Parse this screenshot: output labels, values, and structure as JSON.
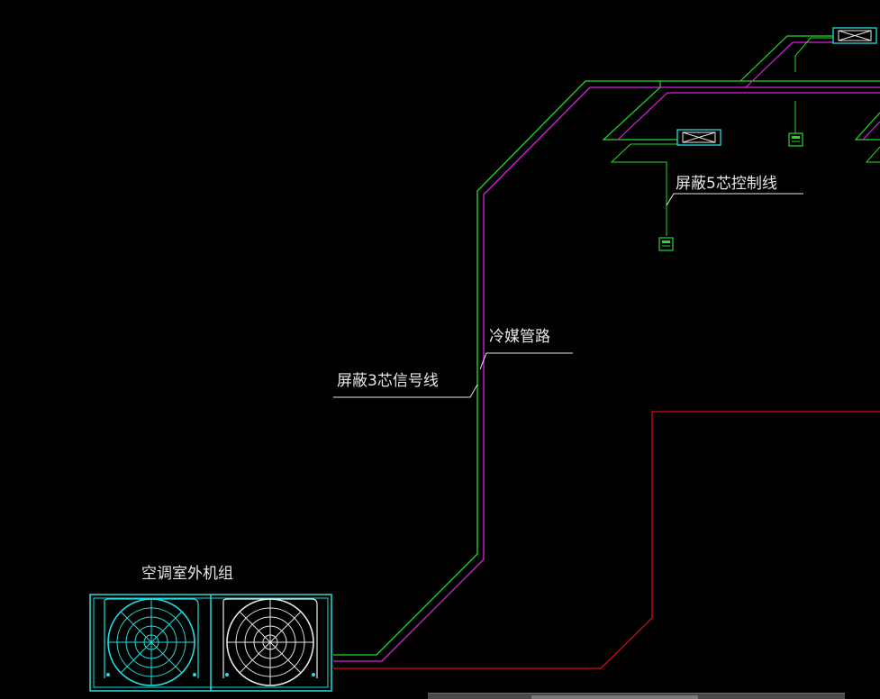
{
  "labels": {
    "outdoor_unit": "空调室外机组",
    "refrigerant_pipe": "冷媒管路",
    "signal_cable": "屏蔽3芯信号线",
    "control_cable": "屏蔽5芯控制线"
  },
  "colors": {
    "background": "#000000",
    "refrigerant_pipe": "#22dd22",
    "signal_cable": "#dd22dd",
    "control_cable": "#22dd22",
    "boundary_line": "#dd1111",
    "equipment": "#22dddd",
    "leader_line": "#e6e6e6",
    "controller": "#22dd22"
  },
  "icons": {
    "fan": "fan-icon",
    "indoor_unit": "indoor-unit-icon",
    "controller": "wired-controller-icon"
  }
}
